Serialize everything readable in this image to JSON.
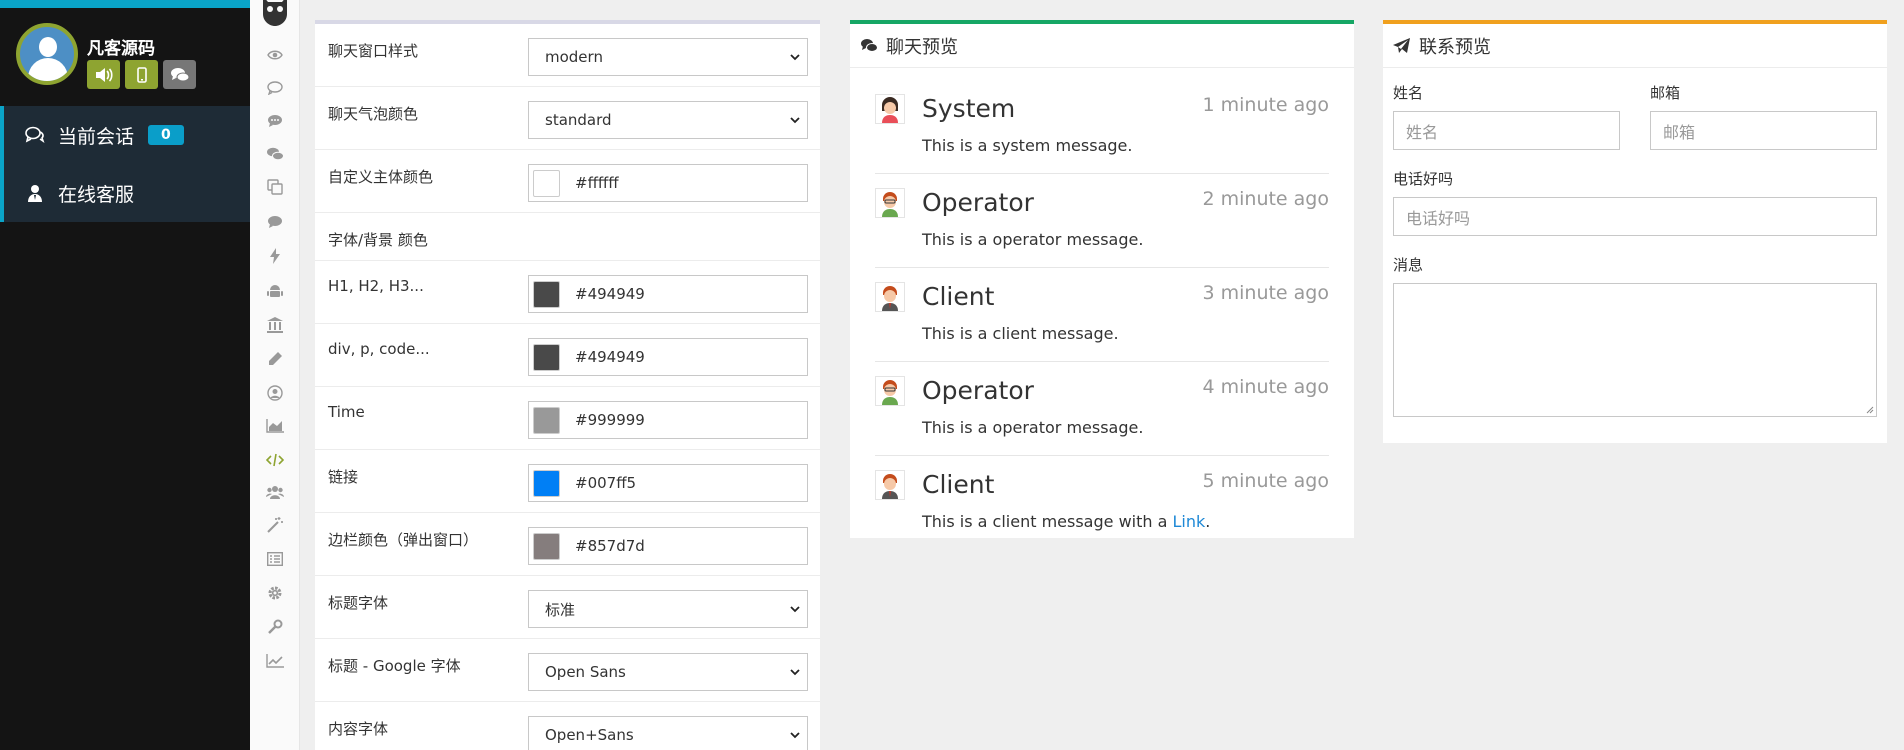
{
  "profile": {
    "name": "凡客源码"
  },
  "menu": [
    {
      "label": "当前会话",
      "badge": "0"
    },
    {
      "label": "在线客服"
    }
  ],
  "rail_icons": [
    "eye-icon",
    "comment-outline-icon",
    "comment-dots-icon",
    "comments-icon",
    "copy-icon",
    "comment-icon",
    "bolt-icon",
    "android-icon",
    "bank-icon",
    "pencil-icon",
    "user-circle-icon",
    "area-chart-icon",
    "code-icon",
    "users-icon",
    "magic-icon",
    "list-alt-icon",
    "gear-icon",
    "wrench-icon",
    "line-chart-icon"
  ],
  "settings": {
    "rows": [
      {
        "label": "聊天窗口样式",
        "type": "select",
        "value": "modern"
      },
      {
        "label": "聊天气泡颜色",
        "type": "select",
        "value": "standard"
      },
      {
        "label": "自定义主体颜色",
        "type": "color",
        "value": "#ffffff",
        "swatch": "#ffffff"
      },
      {
        "label": "字体/背景 颜色",
        "type": "heading"
      },
      {
        "label": "H1, H2, H3...",
        "type": "color",
        "value": "#494949",
        "swatch": "#494949"
      },
      {
        "label": "div, p, code...",
        "type": "color",
        "value": "#494949",
        "swatch": "#494949"
      },
      {
        "label": "Time",
        "type": "color",
        "value": "#999999",
        "swatch": "#999999"
      },
      {
        "label": "链接",
        "type": "color",
        "value": "#007ff5",
        "swatch": "#007ff5"
      },
      {
        "label": "边栏颜色（弹出窗口）",
        "type": "color",
        "value": "#857d7d",
        "swatch": "#857d7d"
      },
      {
        "label": "标题字体",
        "type": "select",
        "value": "标准"
      },
      {
        "label": "标题 - Google 字体",
        "type": "select",
        "value": "Open Sans"
      },
      {
        "label": "内容字体",
        "type": "select",
        "value": "Open+Sans"
      }
    ]
  },
  "chat_preview": {
    "title": "聊天预览",
    "messages": [
      {
        "name": "System",
        "time": "1 minute ago",
        "text": "This is a system message.",
        "avatar": "system"
      },
      {
        "name": "Operator",
        "time": "2 minute ago",
        "text": "This is a operator message.",
        "avatar": "operator"
      },
      {
        "name": "Client",
        "time": "3 minute ago",
        "text": "This is a client message.",
        "avatar": "client"
      },
      {
        "name": "Operator",
        "time": "4 minute ago",
        "text": "This is a operator message.",
        "avatar": "operator"
      },
      {
        "name": "Client",
        "time": "5 minute ago",
        "text": "This is a client message with a ",
        "link": "Link",
        "suffix": ".",
        "avatar": "client"
      }
    ]
  },
  "contact_preview": {
    "title": "联系预览",
    "name_label": "姓名",
    "name_placeholder": "姓名",
    "email_label": "邮箱",
    "email_placeholder": "邮箱",
    "phone_label": "电话好吗",
    "phone_placeholder": "电话好吗",
    "message_label": "消息"
  },
  "colors": {
    "accent_blue": "#0aa4c8",
    "profile_green": "#8ea431",
    "chat_border": "#16a765",
    "contact_border": "#f0a01e",
    "link": "#1e88d6"
  }
}
